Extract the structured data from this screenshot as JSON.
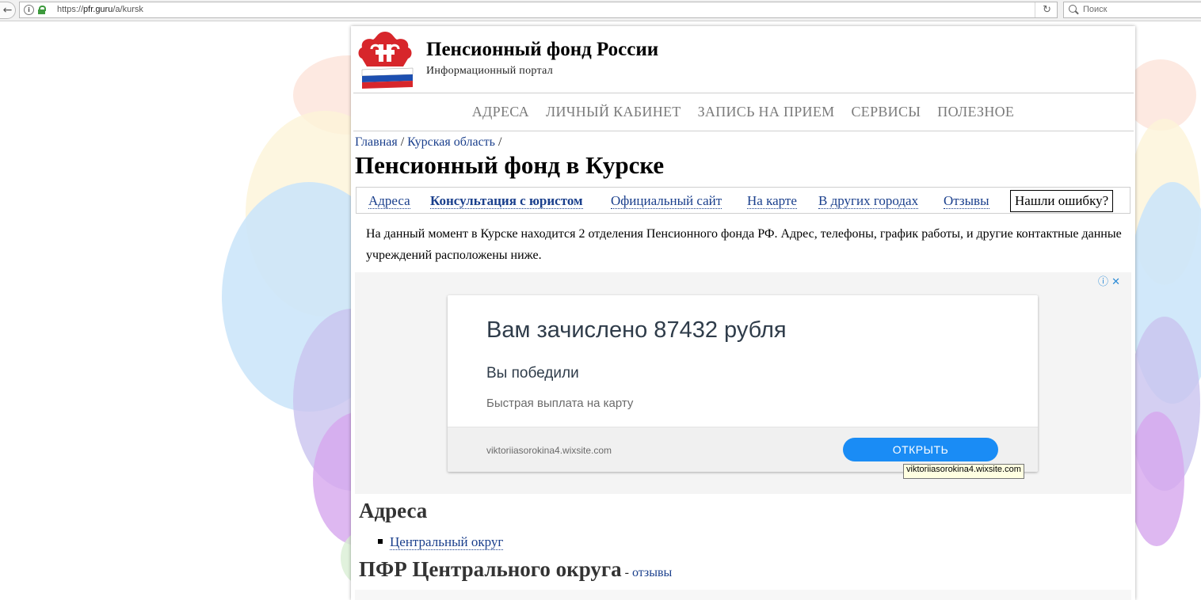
{
  "browser": {
    "url_prefix": "https://",
    "url_host": "pfr.guru",
    "url_path": "/a/kursk",
    "search_placeholder": "Поиск"
  },
  "site": {
    "title": "Пенсионный фонд России",
    "subtitle": "Информационный портал"
  },
  "main_nav": [
    "АДРЕСА",
    "ЛИЧНЫЙ КАБИНЕТ",
    "ЗАПИСЬ НА ПРИЕМ",
    "СЕРВИСЫ",
    "ПОЛЕЗНОЕ"
  ],
  "breadcrumb": {
    "home": "Главная",
    "region": "Курская область",
    "separator": " / "
  },
  "page_title": "Пенсионный фонд в Курске",
  "tabs": {
    "addresses": "Адреса",
    "lawyer": "Консультация с юристом",
    "official": "Официальный сайт",
    "map": "На карте",
    "other_cities": "В других городах",
    "reviews": "Отзывы",
    "report_error": "Нашли ошибку?"
  },
  "intro": "На данный момент в Курске находится 2 отделения Пенсионного фонда РФ. Адрес, телефоны, график работы, и другие контактные данные учреждений расположены ниже.",
  "ad": {
    "headline": "Вам зачислено 87432 рубля",
    "subheadline": "Вы победили",
    "description": "Быстрая выплата на карту",
    "domain": "viktoriiasorokina4.wixsite.com",
    "button": "ОТКРЫТЬ",
    "tooltip": "viktoriiasorokina4.wixsite.com",
    "choices_icon": "ⓘ",
    "close_icon": "✕"
  },
  "sections": {
    "addresses_title": "Адреса",
    "district_link": "Центральный округ",
    "district_title": "ПФР Центрального округа",
    "reviews_sep": " - ",
    "reviews_link": "отзывы"
  },
  "colors": {
    "link": "#1a3f8c",
    "nav_text": "#7a7a7a",
    "ad_button": "#1a8cf5"
  }
}
